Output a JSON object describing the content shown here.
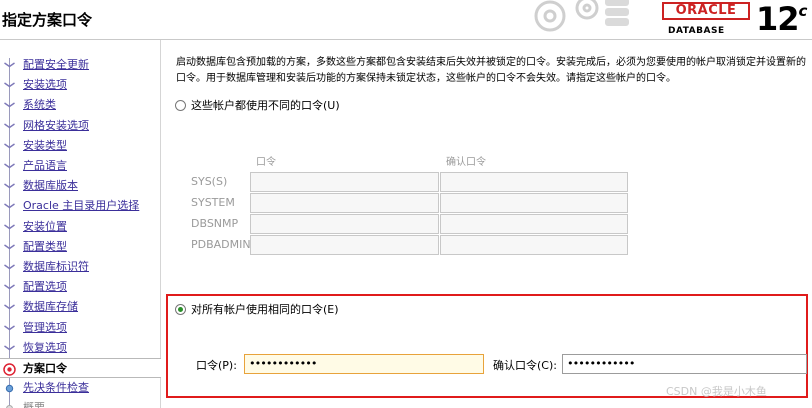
{
  "window": {
    "title": "指定方案口令"
  },
  "logo": {
    "brand": "ORACLE",
    "product": "DATABASE",
    "version": "12",
    "version_suffix": "c"
  },
  "sidebar": {
    "items": [
      {
        "label": "配置安全更新",
        "state": "done"
      },
      {
        "label": "安装选项",
        "state": "done"
      },
      {
        "label": "系统类",
        "state": "done"
      },
      {
        "label": "网格安装选项",
        "state": "done"
      },
      {
        "label": "安装类型",
        "state": "done"
      },
      {
        "label": "产品语言",
        "state": "done"
      },
      {
        "label": "数据库版本",
        "state": "done"
      },
      {
        "label": "Oracle 主目录用户选择",
        "state": "done"
      },
      {
        "label": "安装位置",
        "state": "done"
      },
      {
        "label": "配置类型",
        "state": "done"
      },
      {
        "label": "数据库标识符",
        "state": "done"
      },
      {
        "label": "配置选项",
        "state": "done"
      },
      {
        "label": "数据库存储",
        "state": "done"
      },
      {
        "label": "管理选项",
        "state": "done"
      },
      {
        "label": "恢复选项",
        "state": "done"
      },
      {
        "label": "方案口令",
        "state": "active"
      },
      {
        "label": "先决条件检查",
        "state": "pending"
      },
      {
        "label": "概要",
        "state": "dim"
      }
    ]
  },
  "main": {
    "description": "启动数据库包含预加载的方案，多数这些方案都包含安装结束后失效并被锁定的口令。安装完成后，必须为您要使用的帐户取消锁定并设置新的口令。用于数据库管理和安装后功能的方案保持未锁定状态，这些帐户的口令不会失效。请指定这些帐户的口令。",
    "option_different": "这些帐户都使用不同的口令(U)",
    "col_password": "口令",
    "col_confirm": "确认口令",
    "accounts": [
      "SYS(S)",
      "SYSTEM",
      "DBSNMP",
      "PDBADMIN"
    ],
    "option_same": "对所有帐户使用相同的口令(E)",
    "password_label": "口令(P):",
    "password_value": "••••••••••••",
    "confirm_label": "确认口令(C):",
    "confirm_value": "••••••••••••"
  },
  "watermark": "CSDN @我是小木鱼",
  "colors": {
    "accent": "#e01b1b",
    "link": "#3b2f9a",
    "radio_selected": "#2a8f2a"
  }
}
